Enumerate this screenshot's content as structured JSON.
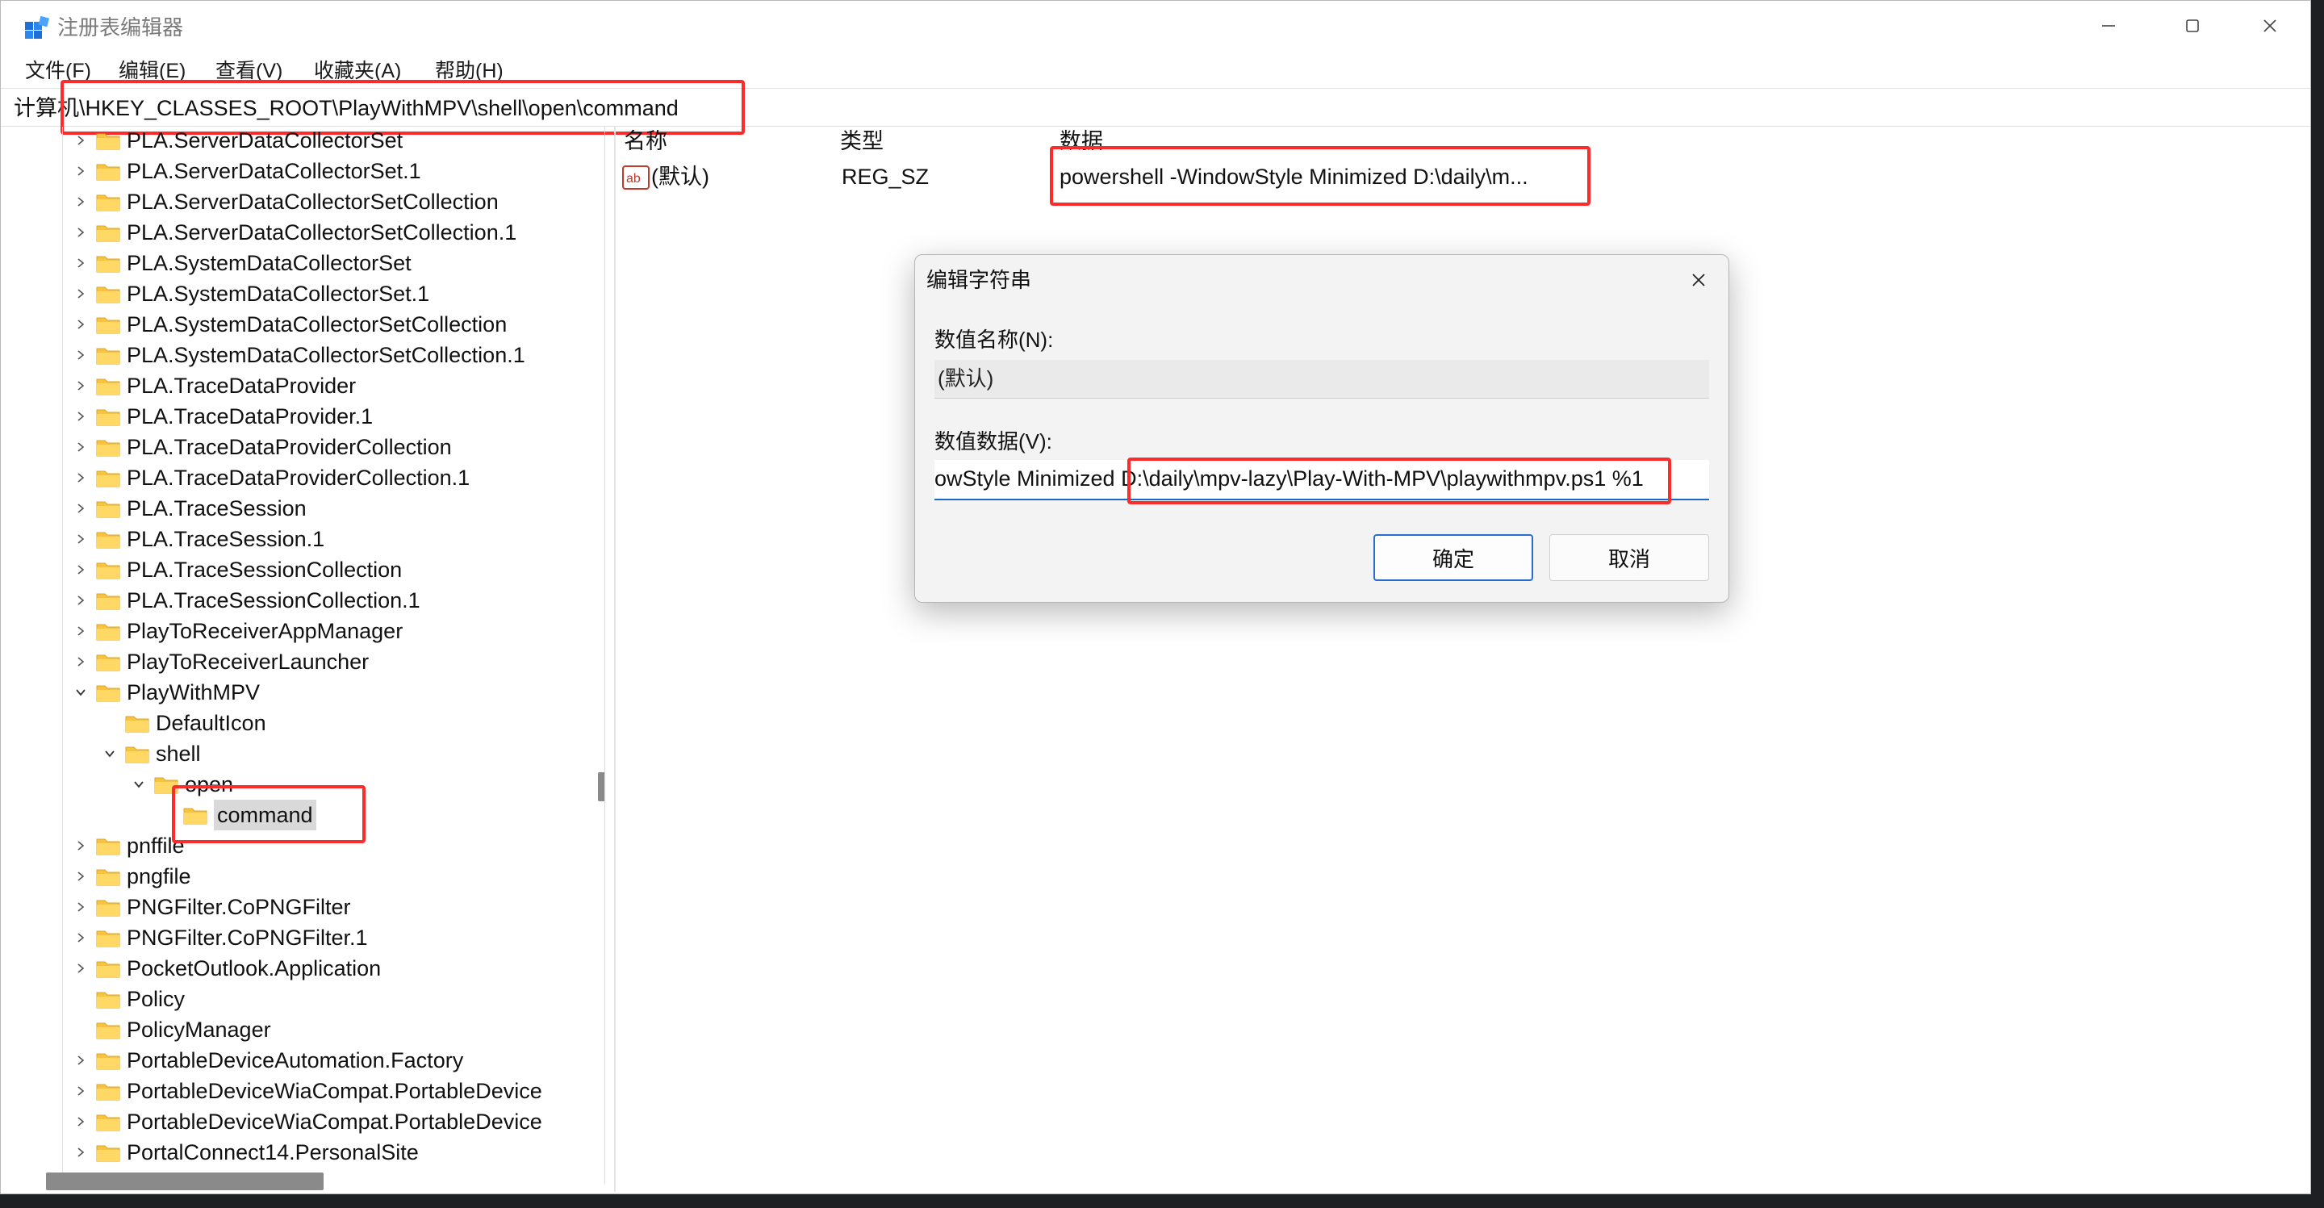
{
  "window": {
    "title": "注册表编辑器",
    "caption_buttons": [
      "minimize",
      "maximize",
      "close"
    ]
  },
  "menu": {
    "items": [
      "文件(F)",
      "编辑(E)",
      "查看(V)",
      "收藏夹(A)",
      "帮助(H)"
    ]
  },
  "address": {
    "path": "计算机\\HKEY_CLASSES_ROOT\\PlayWithMPV\\shell\\open\\command"
  },
  "tree": {
    "items": [
      {
        "label": "PLA.ServerDataCollectorSet",
        "depth": 0,
        "expander": "collapsed"
      },
      {
        "label": "PLA.ServerDataCollectorSet.1",
        "depth": 0,
        "expander": "collapsed"
      },
      {
        "label": "PLA.ServerDataCollectorSetCollection",
        "depth": 0,
        "expander": "collapsed"
      },
      {
        "label": "PLA.ServerDataCollectorSetCollection.1",
        "depth": 0,
        "expander": "collapsed"
      },
      {
        "label": "PLA.SystemDataCollectorSet",
        "depth": 0,
        "expander": "collapsed"
      },
      {
        "label": "PLA.SystemDataCollectorSet.1",
        "depth": 0,
        "expander": "collapsed"
      },
      {
        "label": "PLA.SystemDataCollectorSetCollection",
        "depth": 0,
        "expander": "collapsed"
      },
      {
        "label": "PLA.SystemDataCollectorSetCollection.1",
        "depth": 0,
        "expander": "collapsed"
      },
      {
        "label": "PLA.TraceDataProvider",
        "depth": 0,
        "expander": "collapsed"
      },
      {
        "label": "PLA.TraceDataProvider.1",
        "depth": 0,
        "expander": "collapsed"
      },
      {
        "label": "PLA.TraceDataProviderCollection",
        "depth": 0,
        "expander": "collapsed"
      },
      {
        "label": "PLA.TraceDataProviderCollection.1",
        "depth": 0,
        "expander": "collapsed"
      },
      {
        "label": "PLA.TraceSession",
        "depth": 0,
        "expander": "collapsed"
      },
      {
        "label": "PLA.TraceSession.1",
        "depth": 0,
        "expander": "collapsed"
      },
      {
        "label": "PLA.TraceSessionCollection",
        "depth": 0,
        "expander": "collapsed"
      },
      {
        "label": "PLA.TraceSessionCollection.1",
        "depth": 0,
        "expander": "collapsed"
      },
      {
        "label": "PlayToReceiverAppManager",
        "depth": 0,
        "expander": "collapsed"
      },
      {
        "label": "PlayToReceiverLauncher",
        "depth": 0,
        "expander": "collapsed"
      },
      {
        "label": "PlayWithMPV",
        "depth": 0,
        "expander": "expanded"
      },
      {
        "label": "DefaultIcon",
        "depth": 1,
        "expander": "none"
      },
      {
        "label": "shell",
        "depth": 1,
        "expander": "expanded"
      },
      {
        "label": "open",
        "depth": 2,
        "expander": "expanded"
      },
      {
        "label": "command",
        "depth": 3,
        "expander": "none",
        "selected": true
      },
      {
        "label": "pnffile",
        "depth": 0,
        "expander": "collapsed"
      },
      {
        "label": "pngfile",
        "depth": 0,
        "expander": "collapsed"
      },
      {
        "label": "PNGFilter.CoPNGFilter",
        "depth": 0,
        "expander": "collapsed"
      },
      {
        "label": "PNGFilter.CoPNGFilter.1",
        "depth": 0,
        "expander": "collapsed"
      },
      {
        "label": "PocketOutlook.Application",
        "depth": 0,
        "expander": "collapsed"
      },
      {
        "label": "Policy",
        "depth": 0,
        "expander": "none"
      },
      {
        "label": "PolicyManager",
        "depth": 0,
        "expander": "none"
      },
      {
        "label": "PortableDeviceAutomation.Factory",
        "depth": 0,
        "expander": "collapsed"
      },
      {
        "label": "PortableDeviceWiaCompat.PortableDevice",
        "depth": 0,
        "expander": "collapsed"
      },
      {
        "label": "PortableDeviceWiaCompat.PortableDevice",
        "depth": 0,
        "expander": "collapsed"
      },
      {
        "label": "PortalConnect14.PersonalSite",
        "depth": 0,
        "expander": "collapsed"
      }
    ]
  },
  "values": {
    "headers": {
      "name": "名称",
      "type": "类型",
      "data": "数据"
    },
    "rows": [
      {
        "name": "(默认)",
        "type": "REG_SZ",
        "data": "powershell -WindowStyle Minimized D:\\daily\\m..."
      }
    ]
  },
  "dialog": {
    "title": "编辑字符串",
    "name_label": "数值名称(N):",
    "name_value": "(默认)",
    "data_label": "数值数据(V):",
    "data_value_visible_prefix": "owStyle Minimized ",
    "data_value_visible_path": "D:\\daily\\mpv-lazy\\Play-With-MPV\\playwithmpv.ps1",
    "data_value_visible_suffix": " %1",
    "ok_label": "确定",
    "cancel_label": "取消"
  },
  "colors": {
    "highlight_box": "#ff2a2a",
    "focus_underline": "#1967c8",
    "folder": "#f6c445"
  }
}
